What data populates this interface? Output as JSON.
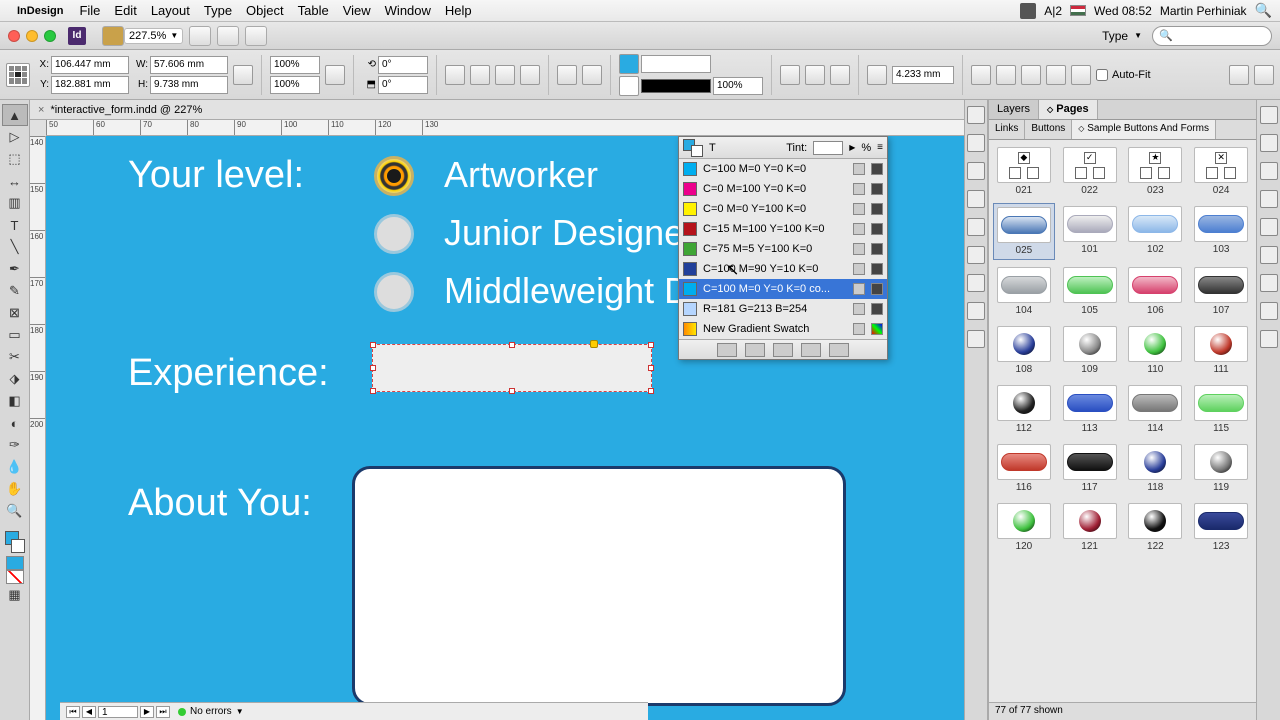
{
  "menubar": {
    "app": "InDesign",
    "items": [
      "File",
      "Edit",
      "Layout",
      "Type",
      "Object",
      "Table",
      "View",
      "Window",
      "Help"
    ],
    "right": {
      "clock": "Wed 08:52",
      "user": "Martin Perhiniak",
      "adobe": "A|2"
    }
  },
  "titlebar": {
    "zoom": "227.5%",
    "typelabel": "Type"
  },
  "controlbar": {
    "x": "106.447 mm",
    "y": "182.881 mm",
    "w": "57.606 mm",
    "h": "9.738 mm",
    "scalex": "100%",
    "scaley": "100%",
    "rot": "0°",
    "shear": "0°",
    "strokew": "100%",
    "inset": "4.233 mm",
    "autofit": "Auto-Fit"
  },
  "doctab": {
    "name": "*interactive_form.indd @ 227%"
  },
  "ruler_h": [
    "50",
    "60",
    "70",
    "80",
    "90",
    "100",
    "110",
    "120",
    "130"
  ],
  "ruler_v": [
    "140",
    "150",
    "160",
    "170",
    "180",
    "190",
    "200"
  ],
  "canvas": {
    "level_label": "Your level:",
    "opts": [
      "Artworker",
      "Junior Designer",
      "Middleweight D"
    ],
    "exp_label": "Experience:",
    "about_label": "About You:"
  },
  "swatches": {
    "tint_label": "Tint:",
    "tint_unit": "%",
    "rows": [
      {
        "name": "C=100 M=0 Y=0 K=0",
        "color": "#00aeef"
      },
      {
        "name": "C=0 M=100 Y=0 K=0",
        "color": "#ec008c"
      },
      {
        "name": "C=0 M=0 Y=100 K=0",
        "color": "#fff200"
      },
      {
        "name": "C=15 M=100 Y=100 K=0",
        "color": "#b5121b"
      },
      {
        "name": "C=75 M=5 Y=100 K=0",
        "color": "#3fa535"
      },
      {
        "name": "C=100 M=90 Y=10 K=0",
        "color": "#21409a"
      },
      {
        "name": "C=100 M=0 Y=0 K=0 co...",
        "color": "#00aeef",
        "sel": true
      },
      {
        "name": "R=181 G=213 B=254",
        "color": "#b5d5fe"
      },
      {
        "name": "New Gradient Swatch",
        "color": "linear-gradient(90deg,#ff8a00,#ffe600)",
        "grad": true
      }
    ]
  },
  "rightpanel": {
    "tabs": [
      "Layers",
      "Pages"
    ],
    "subtabs": [
      "Links",
      "Buttons",
      "Sample Buttons And Forms"
    ],
    "grid": [
      {
        "id": "021",
        "t": "chk",
        "v": "◆"
      },
      {
        "id": "022",
        "t": "chk",
        "v": "✓"
      },
      {
        "id": "023",
        "t": "chk",
        "v": "★"
      },
      {
        "id": "024",
        "t": "chk",
        "v": "✕"
      },
      {
        "id": "025",
        "t": "pill",
        "c1": "#4a77b5",
        "c2": "#d7e2f1",
        "sel": true
      },
      {
        "id": "101",
        "t": "pill",
        "c1": "#aab",
        "c2": "#eee"
      },
      {
        "id": "102",
        "t": "pill",
        "c1": "#8db7e8",
        "c2": "#d8e8f7"
      },
      {
        "id": "103",
        "t": "pill",
        "c1": "#4d7fd1",
        "c2": "#9ab6e2"
      },
      {
        "id": "104",
        "t": "pill",
        "c1": "#9aa0a5",
        "c2": "#d6d8da"
      },
      {
        "id": "105",
        "t": "pill",
        "c1": "#4fc354",
        "c2": "#bdf0bf"
      },
      {
        "id": "106",
        "t": "pill",
        "c1": "#d6416d",
        "c2": "#f2b8c8"
      },
      {
        "id": "107",
        "t": "pill",
        "c1": "#333",
        "c2": "#888"
      },
      {
        "id": "108",
        "t": "sphere",
        "c": "#2a3f9a"
      },
      {
        "id": "109",
        "t": "sphere",
        "c": "#888"
      },
      {
        "id": "110",
        "t": "sphere",
        "c": "#3fc13f"
      },
      {
        "id": "111",
        "t": "sphere",
        "c": "#c0392b"
      },
      {
        "id": "112",
        "t": "sphere",
        "c": "#222"
      },
      {
        "id": "113",
        "t": "pill",
        "c1": "#2a4fc1",
        "c2": "#6a8ae0"
      },
      {
        "id": "114",
        "t": "pill",
        "c1": "#777",
        "c2": "#bbb"
      },
      {
        "id": "115",
        "t": "pill",
        "c1": "#5fd15f",
        "c2": "#b8f0b8"
      },
      {
        "id": "116",
        "t": "pill",
        "c1": "#c0392b",
        "c2": "#e98b82"
      },
      {
        "id": "117",
        "t": "pill",
        "c1": "#111",
        "c2": "#555"
      },
      {
        "id": "118",
        "t": "sphere",
        "c": "#2a3f9a"
      },
      {
        "id": "119",
        "t": "sphere",
        "c": "#777"
      },
      {
        "id": "120",
        "t": "sphere",
        "c": "#3fc13f"
      },
      {
        "id": "121",
        "t": "sphere",
        "c": "#a02035"
      },
      {
        "id": "122",
        "t": "sphere",
        "c": "#111"
      },
      {
        "id": "123",
        "t": "pill",
        "c1": "#1a2a6b",
        "c2": "#3a4a9b"
      }
    ],
    "status": "77 of 77 shown"
  },
  "bottombar": {
    "page": "1",
    "errors": "No errors"
  }
}
